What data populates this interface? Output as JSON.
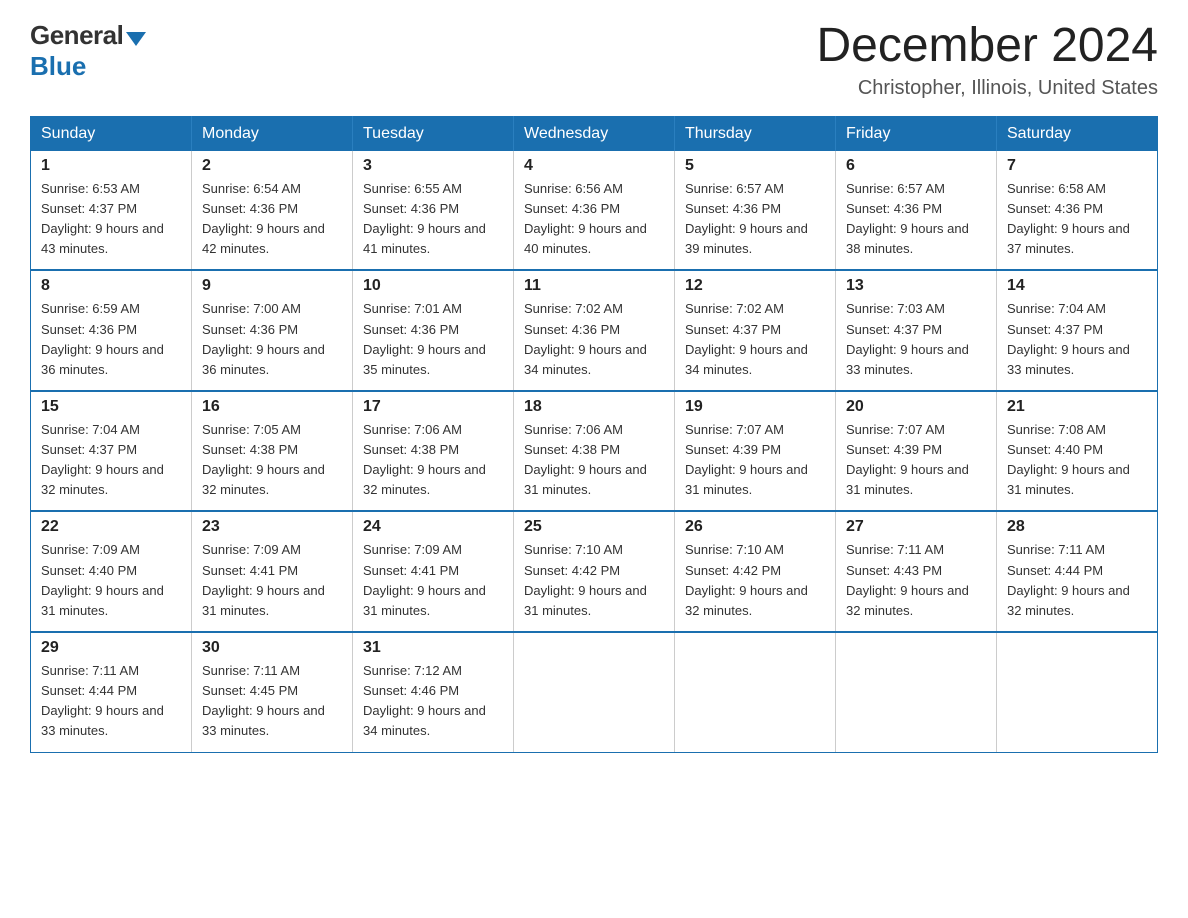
{
  "logo": {
    "general": "General",
    "blue": "Blue"
  },
  "title": "December 2024",
  "location": "Christopher, Illinois, United States",
  "weekdays": [
    "Sunday",
    "Monday",
    "Tuesday",
    "Wednesday",
    "Thursday",
    "Friday",
    "Saturday"
  ],
  "weeks": [
    [
      {
        "day": "1",
        "sunrise": "6:53 AM",
        "sunset": "4:37 PM",
        "daylight": "9 hours and 43 minutes."
      },
      {
        "day": "2",
        "sunrise": "6:54 AM",
        "sunset": "4:36 PM",
        "daylight": "9 hours and 42 minutes."
      },
      {
        "day": "3",
        "sunrise": "6:55 AM",
        "sunset": "4:36 PM",
        "daylight": "9 hours and 41 minutes."
      },
      {
        "day": "4",
        "sunrise": "6:56 AM",
        "sunset": "4:36 PM",
        "daylight": "9 hours and 40 minutes."
      },
      {
        "day": "5",
        "sunrise": "6:57 AM",
        "sunset": "4:36 PM",
        "daylight": "9 hours and 39 minutes."
      },
      {
        "day": "6",
        "sunrise": "6:57 AM",
        "sunset": "4:36 PM",
        "daylight": "9 hours and 38 minutes."
      },
      {
        "day": "7",
        "sunrise": "6:58 AM",
        "sunset": "4:36 PM",
        "daylight": "9 hours and 37 minutes."
      }
    ],
    [
      {
        "day": "8",
        "sunrise": "6:59 AM",
        "sunset": "4:36 PM",
        "daylight": "9 hours and 36 minutes."
      },
      {
        "day": "9",
        "sunrise": "7:00 AM",
        "sunset": "4:36 PM",
        "daylight": "9 hours and 36 minutes."
      },
      {
        "day": "10",
        "sunrise": "7:01 AM",
        "sunset": "4:36 PM",
        "daylight": "9 hours and 35 minutes."
      },
      {
        "day": "11",
        "sunrise": "7:02 AM",
        "sunset": "4:36 PM",
        "daylight": "9 hours and 34 minutes."
      },
      {
        "day": "12",
        "sunrise": "7:02 AM",
        "sunset": "4:37 PM",
        "daylight": "9 hours and 34 minutes."
      },
      {
        "day": "13",
        "sunrise": "7:03 AM",
        "sunset": "4:37 PM",
        "daylight": "9 hours and 33 minutes."
      },
      {
        "day": "14",
        "sunrise": "7:04 AM",
        "sunset": "4:37 PM",
        "daylight": "9 hours and 33 minutes."
      }
    ],
    [
      {
        "day": "15",
        "sunrise": "7:04 AM",
        "sunset": "4:37 PM",
        "daylight": "9 hours and 32 minutes."
      },
      {
        "day": "16",
        "sunrise": "7:05 AM",
        "sunset": "4:38 PM",
        "daylight": "9 hours and 32 minutes."
      },
      {
        "day": "17",
        "sunrise": "7:06 AM",
        "sunset": "4:38 PM",
        "daylight": "9 hours and 32 minutes."
      },
      {
        "day": "18",
        "sunrise": "7:06 AM",
        "sunset": "4:38 PM",
        "daylight": "9 hours and 31 minutes."
      },
      {
        "day": "19",
        "sunrise": "7:07 AM",
        "sunset": "4:39 PM",
        "daylight": "9 hours and 31 minutes."
      },
      {
        "day": "20",
        "sunrise": "7:07 AM",
        "sunset": "4:39 PM",
        "daylight": "9 hours and 31 minutes."
      },
      {
        "day": "21",
        "sunrise": "7:08 AM",
        "sunset": "4:40 PM",
        "daylight": "9 hours and 31 minutes."
      }
    ],
    [
      {
        "day": "22",
        "sunrise": "7:09 AM",
        "sunset": "4:40 PM",
        "daylight": "9 hours and 31 minutes."
      },
      {
        "day": "23",
        "sunrise": "7:09 AM",
        "sunset": "4:41 PM",
        "daylight": "9 hours and 31 minutes."
      },
      {
        "day": "24",
        "sunrise": "7:09 AM",
        "sunset": "4:41 PM",
        "daylight": "9 hours and 31 minutes."
      },
      {
        "day": "25",
        "sunrise": "7:10 AM",
        "sunset": "4:42 PM",
        "daylight": "9 hours and 31 minutes."
      },
      {
        "day": "26",
        "sunrise": "7:10 AM",
        "sunset": "4:42 PM",
        "daylight": "9 hours and 32 minutes."
      },
      {
        "day": "27",
        "sunrise": "7:11 AM",
        "sunset": "4:43 PM",
        "daylight": "9 hours and 32 minutes."
      },
      {
        "day": "28",
        "sunrise": "7:11 AM",
        "sunset": "4:44 PM",
        "daylight": "9 hours and 32 minutes."
      }
    ],
    [
      {
        "day": "29",
        "sunrise": "7:11 AM",
        "sunset": "4:44 PM",
        "daylight": "9 hours and 33 minutes."
      },
      {
        "day": "30",
        "sunrise": "7:11 AM",
        "sunset": "4:45 PM",
        "daylight": "9 hours and 33 minutes."
      },
      {
        "day": "31",
        "sunrise": "7:12 AM",
        "sunset": "4:46 PM",
        "daylight": "9 hours and 34 minutes."
      },
      null,
      null,
      null,
      null
    ]
  ]
}
